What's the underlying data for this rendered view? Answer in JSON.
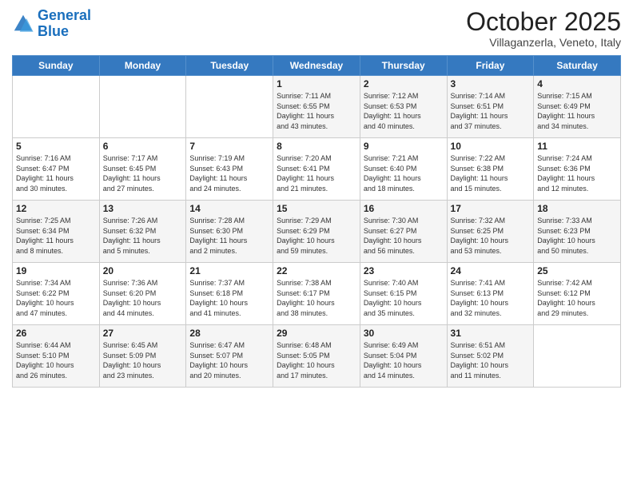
{
  "logo": {
    "line1": "General",
    "line2": "Blue"
  },
  "title": "October 2025",
  "location": "Villaganzerla, Veneto, Italy",
  "days_of_week": [
    "Sunday",
    "Monday",
    "Tuesday",
    "Wednesday",
    "Thursday",
    "Friday",
    "Saturday"
  ],
  "weeks": [
    [
      {
        "day": "",
        "info": ""
      },
      {
        "day": "",
        "info": ""
      },
      {
        "day": "",
        "info": ""
      },
      {
        "day": "1",
        "info": "Sunrise: 7:11 AM\nSunset: 6:55 PM\nDaylight: 11 hours\nand 43 minutes."
      },
      {
        "day": "2",
        "info": "Sunrise: 7:12 AM\nSunset: 6:53 PM\nDaylight: 11 hours\nand 40 minutes."
      },
      {
        "day": "3",
        "info": "Sunrise: 7:14 AM\nSunset: 6:51 PM\nDaylight: 11 hours\nand 37 minutes."
      },
      {
        "day": "4",
        "info": "Sunrise: 7:15 AM\nSunset: 6:49 PM\nDaylight: 11 hours\nand 34 minutes."
      }
    ],
    [
      {
        "day": "5",
        "info": "Sunrise: 7:16 AM\nSunset: 6:47 PM\nDaylight: 11 hours\nand 30 minutes."
      },
      {
        "day": "6",
        "info": "Sunrise: 7:17 AM\nSunset: 6:45 PM\nDaylight: 11 hours\nand 27 minutes."
      },
      {
        "day": "7",
        "info": "Sunrise: 7:19 AM\nSunset: 6:43 PM\nDaylight: 11 hours\nand 24 minutes."
      },
      {
        "day": "8",
        "info": "Sunrise: 7:20 AM\nSunset: 6:41 PM\nDaylight: 11 hours\nand 21 minutes."
      },
      {
        "day": "9",
        "info": "Sunrise: 7:21 AM\nSunset: 6:40 PM\nDaylight: 11 hours\nand 18 minutes."
      },
      {
        "day": "10",
        "info": "Sunrise: 7:22 AM\nSunset: 6:38 PM\nDaylight: 11 hours\nand 15 minutes."
      },
      {
        "day": "11",
        "info": "Sunrise: 7:24 AM\nSunset: 6:36 PM\nDaylight: 11 hours\nand 12 minutes."
      }
    ],
    [
      {
        "day": "12",
        "info": "Sunrise: 7:25 AM\nSunset: 6:34 PM\nDaylight: 11 hours\nand 8 minutes."
      },
      {
        "day": "13",
        "info": "Sunrise: 7:26 AM\nSunset: 6:32 PM\nDaylight: 11 hours\nand 5 minutes."
      },
      {
        "day": "14",
        "info": "Sunrise: 7:28 AM\nSunset: 6:30 PM\nDaylight: 11 hours\nand 2 minutes."
      },
      {
        "day": "15",
        "info": "Sunrise: 7:29 AM\nSunset: 6:29 PM\nDaylight: 10 hours\nand 59 minutes."
      },
      {
        "day": "16",
        "info": "Sunrise: 7:30 AM\nSunset: 6:27 PM\nDaylight: 10 hours\nand 56 minutes."
      },
      {
        "day": "17",
        "info": "Sunrise: 7:32 AM\nSunset: 6:25 PM\nDaylight: 10 hours\nand 53 minutes."
      },
      {
        "day": "18",
        "info": "Sunrise: 7:33 AM\nSunset: 6:23 PM\nDaylight: 10 hours\nand 50 minutes."
      }
    ],
    [
      {
        "day": "19",
        "info": "Sunrise: 7:34 AM\nSunset: 6:22 PM\nDaylight: 10 hours\nand 47 minutes."
      },
      {
        "day": "20",
        "info": "Sunrise: 7:36 AM\nSunset: 6:20 PM\nDaylight: 10 hours\nand 44 minutes."
      },
      {
        "day": "21",
        "info": "Sunrise: 7:37 AM\nSunset: 6:18 PM\nDaylight: 10 hours\nand 41 minutes."
      },
      {
        "day": "22",
        "info": "Sunrise: 7:38 AM\nSunset: 6:17 PM\nDaylight: 10 hours\nand 38 minutes."
      },
      {
        "day": "23",
        "info": "Sunrise: 7:40 AM\nSunset: 6:15 PM\nDaylight: 10 hours\nand 35 minutes."
      },
      {
        "day": "24",
        "info": "Sunrise: 7:41 AM\nSunset: 6:13 PM\nDaylight: 10 hours\nand 32 minutes."
      },
      {
        "day": "25",
        "info": "Sunrise: 7:42 AM\nSunset: 6:12 PM\nDaylight: 10 hours\nand 29 minutes."
      }
    ],
    [
      {
        "day": "26",
        "info": "Sunrise: 6:44 AM\nSunset: 5:10 PM\nDaylight: 10 hours\nand 26 minutes."
      },
      {
        "day": "27",
        "info": "Sunrise: 6:45 AM\nSunset: 5:09 PM\nDaylight: 10 hours\nand 23 minutes."
      },
      {
        "day": "28",
        "info": "Sunrise: 6:47 AM\nSunset: 5:07 PM\nDaylight: 10 hours\nand 20 minutes."
      },
      {
        "day": "29",
        "info": "Sunrise: 6:48 AM\nSunset: 5:05 PM\nDaylight: 10 hours\nand 17 minutes."
      },
      {
        "day": "30",
        "info": "Sunrise: 6:49 AM\nSunset: 5:04 PM\nDaylight: 10 hours\nand 14 minutes."
      },
      {
        "day": "31",
        "info": "Sunrise: 6:51 AM\nSunset: 5:02 PM\nDaylight: 10 hours\nand 11 minutes."
      },
      {
        "day": "",
        "info": ""
      }
    ]
  ]
}
